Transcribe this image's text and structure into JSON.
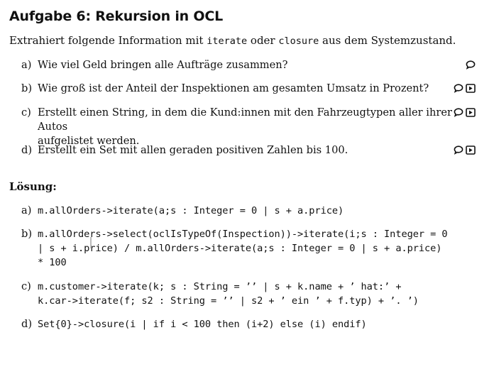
{
  "title": "Aufgabe 6: Rekursion in OCL",
  "intro": {
    "before": "Extrahiert folgende Information mit ",
    "kw1": "iterate",
    "mid": " oder ",
    "kw2": "closure",
    "after": " aus dem Systemzustand."
  },
  "questions": [
    {
      "label": "a)",
      "line1": "Wie viel Geld bringen alle Aufträge zusammen?",
      "line2": ""
    },
    {
      "label": "b)",
      "line1": "Wie groß ist der Anteil der Inspektionen am gesamten Umsatz in Prozent?",
      "line2": ""
    },
    {
      "label": "c)",
      "line1": "Erstellt einen String, in dem die Kund:innen mit den Fahrzeugtypen aller ihrer Autos",
      "line2": "aufgelistet werden."
    },
    {
      "label": "d)",
      "line1": "Erstellt ein Set mit allen geraden positiven Zahlen bis 100.",
      "line2": ""
    }
  ],
  "solution_heading": "Lösung:",
  "answers": [
    {
      "label": "a)",
      "lines": [
        "m.allOrders->iterate(a;s : Integer = 0 | s + a.price)"
      ]
    },
    {
      "label": "b)",
      "lines": [
        "m.allOrders->select(oclIsTypeOf(Inspection))->iterate(i;s : Integer = 0",
        "| s + i.price) / m.allOrders->iterate(a;s : Integer = 0 | s + a.price)",
        "* 100"
      ]
    },
    {
      "label": "c)",
      "lines": [
        "m.customer->iterate(k; s : String = ’’ | s + k.name + ’ hat:’ +",
        "k.car->iterate(f; s2 : String = ’’ | s2 + ’ ein ’ + f.typ) + ’. ’)"
      ]
    },
    {
      "label": "d)",
      "lines": [
        "Set{0}->closure(i | if i < 100 then (i+2) else (i) endif)"
      ]
    }
  ]
}
